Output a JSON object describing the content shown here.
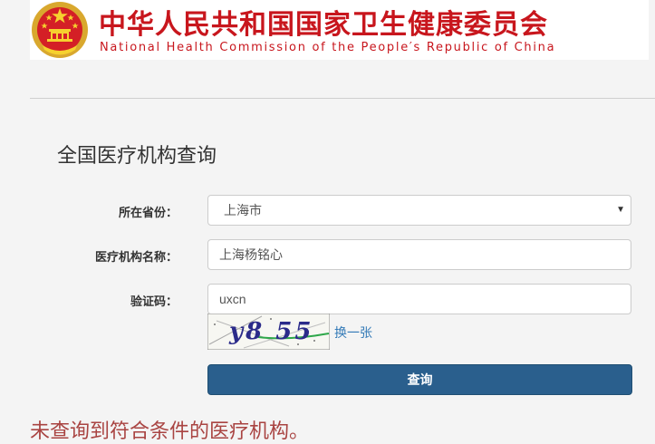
{
  "header": {
    "title_cn": "中华人民共和国国家卫生健康委员会",
    "title_en": "National Health Commission of the People′s Republic of China",
    "emblem_icon": "national-emblem-icon",
    "brand_color": "#c8161d"
  },
  "page": {
    "title": "全国医疗机构查询"
  },
  "form": {
    "province": {
      "label": "所在省份：",
      "value": "上海市",
      "icon": "chevron-down-icon"
    },
    "institution": {
      "label": "医疗机构名称：",
      "value": "上海杨铭心"
    },
    "captcha": {
      "label": "验证码：",
      "value": "uxcn",
      "image_text": "y8 55",
      "refresh_label": "换一张"
    },
    "submit_label": "查询",
    "submit_color": "#2a5f8d"
  },
  "result": {
    "message": "未查询到符合条件的医疗机构。",
    "color": "#a94442"
  }
}
